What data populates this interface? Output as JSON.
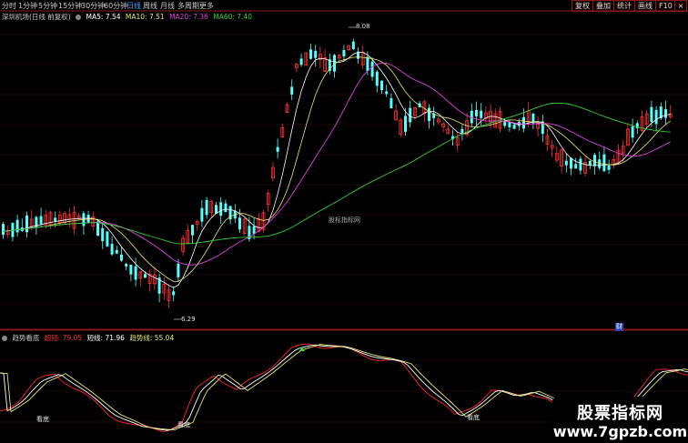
{
  "toolbar": {
    "periods": [
      "分时",
      "1分钟",
      "5分钟",
      "15分钟",
      "30分钟",
      "60分钟",
      "日线",
      "周线",
      "月线",
      "多周期",
      "更多"
    ],
    "active_period": "日线",
    "buttons": [
      "复权",
      "叠加",
      "统计",
      "画线",
      "F10"
    ],
    "controls": [
      "-",
      "×"
    ]
  },
  "main_legend": {
    "title": "深圳机场(日线 前复权)",
    "ma5": "MA5: 7.54",
    "ma10": "MA10: 7.51",
    "ma20": "MA20: 7.36",
    "ma60": "MA60: 7.40"
  },
  "price_marks": {
    "high": "8.08",
    "low": "6.29"
  },
  "watermark": "股标指标网",
  "cai_badge": "财",
  "sub_legend": {
    "title": "趋势看底",
    "line1": "超短: 79.05",
    "line2": "短线: 71.96",
    "line3": "趋势线: 55.04"
  },
  "sub_marks": [
    "看底",
    "看底",
    "看底"
  ],
  "brand": {
    "name": "股票指标网",
    "url": "www.7gpzb.com"
  },
  "colors": {
    "up": "#ff3232",
    "down": "#54ffff",
    "ma5": "#ffffff",
    "ma10": "#e8e870",
    "ma20": "#e040e0",
    "ma60": "#30d030",
    "grid": "#8a1a1a",
    "active": "#4aa0ff"
  }
}
